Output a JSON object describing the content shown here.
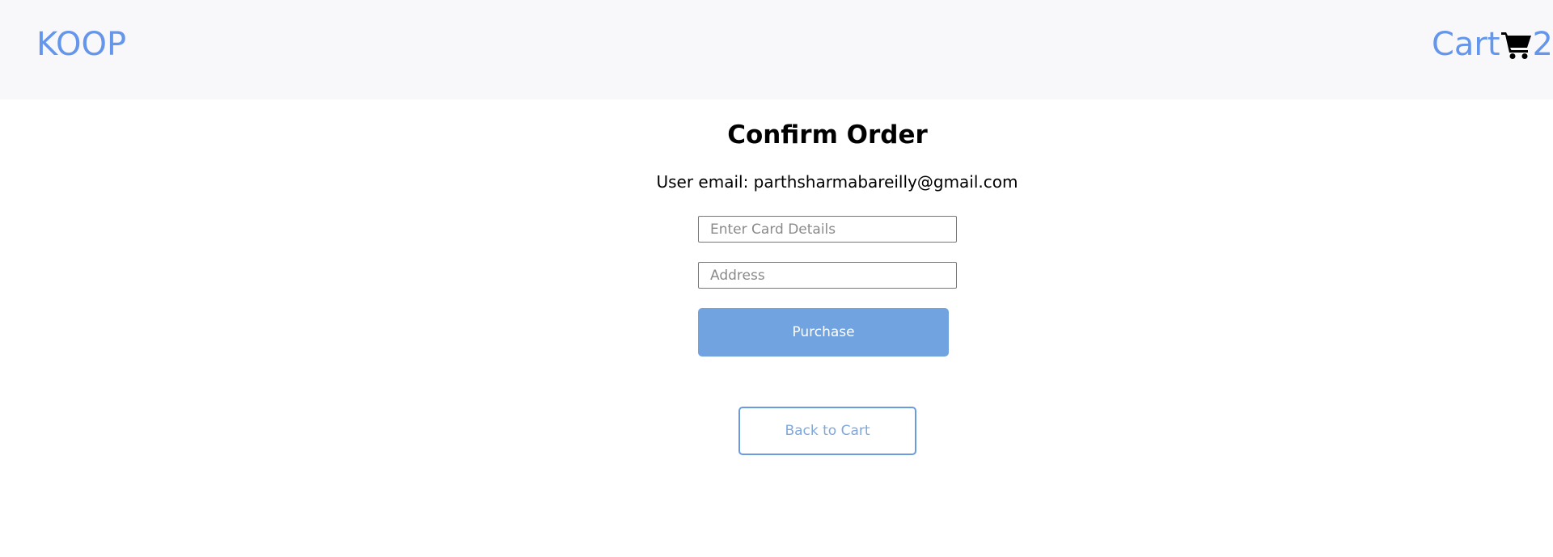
{
  "navbar": {
    "logo": "KOOP",
    "cart_label": "Cart",
    "cart_count": "2",
    "accent_color": "#6496ec",
    "cart_icon": "shopping-cart-icon"
  },
  "main": {
    "title": "Confirm Order",
    "email_line": "User email: parthsharmabareilly@gmail.com",
    "card_placeholder": "Enter Card Details",
    "card_value": "",
    "address_placeholder": "Address",
    "address_value": "",
    "purchase_label": "Purchase",
    "back_label": "Back to Cart",
    "purchase_color": "#70a3df"
  }
}
